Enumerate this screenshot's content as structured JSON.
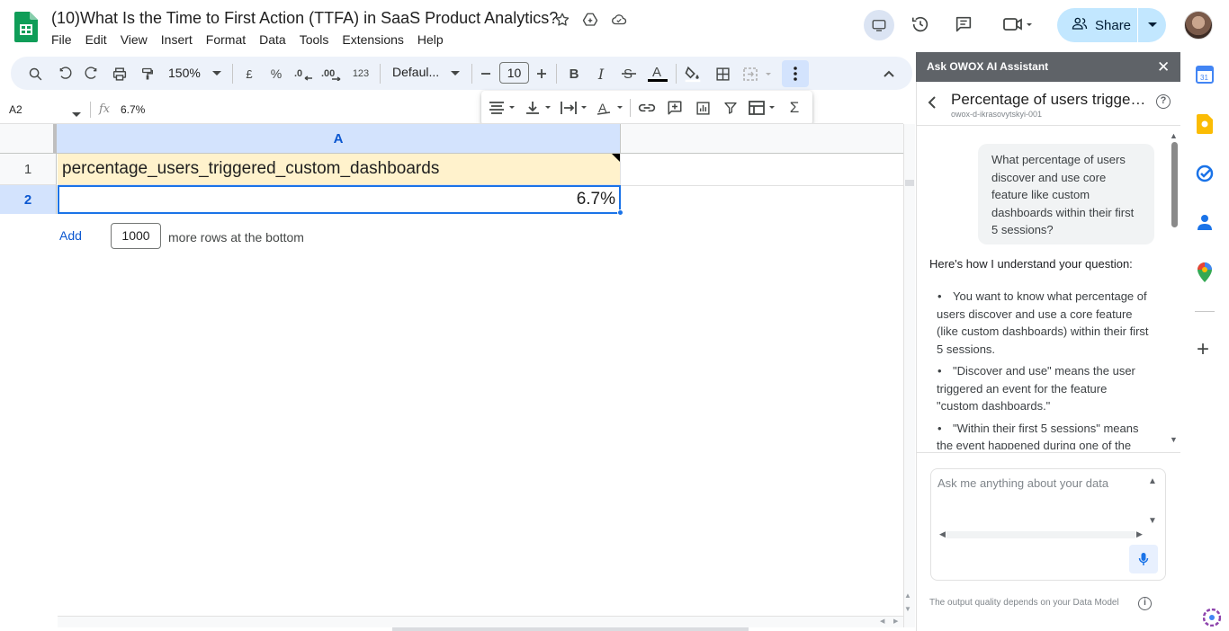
{
  "header": {
    "title": "(10)What Is the Time to First Action (TTFA) in SaaS Product Analytics?",
    "menu": [
      "File",
      "Edit",
      "View",
      "Insert",
      "Format",
      "Data",
      "Tools",
      "Extensions",
      "Help"
    ],
    "share_label": "Share"
  },
  "toolbar": {
    "zoom": "150%",
    "currency": "£",
    "percent": "%",
    "number_format": "123",
    "font_name": "Defaul...",
    "font_size": "10"
  },
  "formula_bar": {
    "cell_ref": "A2",
    "value": "6.7%"
  },
  "grid": {
    "column_a": "A",
    "row_numbers": [
      "1",
      "2"
    ],
    "a1": "percentage_users_triggered_custom_dashboards",
    "a2": "6.7%",
    "add_label": "Add",
    "rows_count": "1000",
    "rows_label": "more rows at the bottom"
  },
  "panel": {
    "header": "Ask OWOX AI Assistant",
    "chat_title": "Percentage of users triggerin...",
    "chat_subtitle": "owox-d-ikrasovytskyi-001",
    "user_message": "What percentage of users discover and use core feature like custom dashboards within their first 5 sessions?",
    "bot_intro": "Here's how I understand your question:",
    "bot_points": [
      "You want to know what percentage of users discover and use a core feature (like custom dashboards) within their first 5 sessions.",
      "\"Discover and use\" means the user triggered an event for the feature \"custom dashboards.\"",
      "\"Within their first 5 sessions\" means the event happened during one of the"
    ],
    "input_placeholder": "Ask me anything about your data",
    "footnote": "The output quality depends on your Data Model"
  },
  "colors": {
    "sheets_green": "#0f9d58",
    "accent_blue": "#1a73e8",
    "share_bg": "#c2e7ff",
    "header_cell_bg": "#fff2cc",
    "panel_header_bg": "#5f6368"
  }
}
